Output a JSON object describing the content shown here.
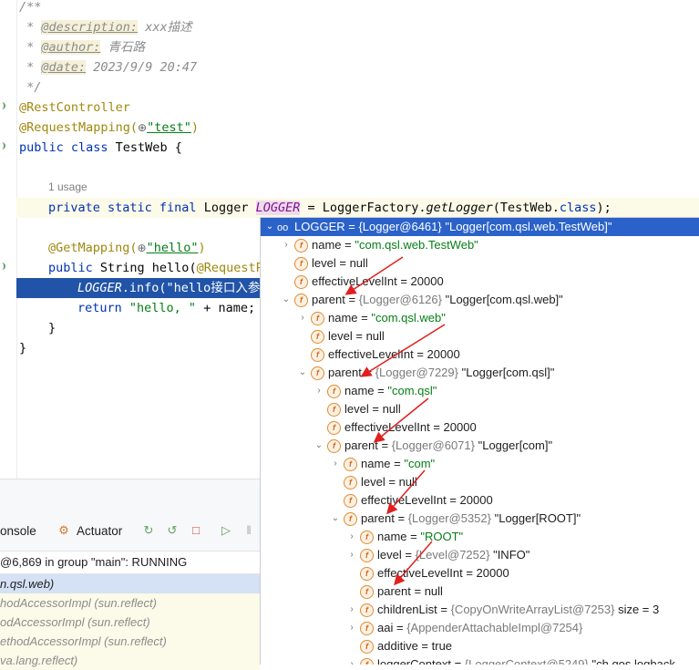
{
  "editor": {
    "comment_open": "/**",
    "desc_tag": "@description:",
    "desc_text": " xxx描述",
    "author_tag": "@author:",
    "author_text": " 青石路",
    "date_tag": "@date:",
    "date_text": " 2023/9/9 20:47",
    "comment_close": " */",
    "ann_rest": "@RestController",
    "ann_reqmap": "@RequestMapping(",
    "reqmap_value": "\"test\"",
    "reqmap_close": ")",
    "class_kw": "public class ",
    "class_name": "TestWeb {",
    "usage_hint": "1 usage",
    "field_kw": "private static final ",
    "field_type": "Logger ",
    "field_name": "LOGGER",
    "field_eq": " = LoggerFactory.",
    "field_method": "getLogger",
    "field_args": "(TestWeb.",
    "field_class_kw": "class",
    "field_end": ");",
    "ann_get": "@GetMapping(",
    "get_value": "\"hello\"",
    "get_close": ")",
    "method_kw": "public ",
    "method_sig": "String hello(",
    "method_ann": "@RequestP",
    "exec_logger": "LOGGER",
    "exec_rest": ".info(\"hello接口入参",
    "return_kw": "return ",
    "return_str": "\"hello, \"",
    "return_rest": " + name;",
    "brace_inner": "}",
    "brace_outer": "}"
  },
  "bottom": {
    "tab_console": "onsole",
    "tab_actuator": "Actuator",
    "thread_status": "@6,869 in group \"main\": RUNNING",
    "frames": [
      "n.qsl.web)",
      "hodAccessorImpl (sun.reflect)",
      "odAccessorImpl (sun.reflect)",
      "ethodAccessorImpl (sun.reflect)",
      "va.lang.reflect)"
    ]
  },
  "debug_tree": [
    {
      "indent": 0,
      "expander": "⌄",
      "icon": "oo",
      "name": "LOGGER",
      "eq": " = ",
      "ref": "{Logger@6461}",
      "value": " \"Logger[com.qsl.web.TestWeb]\"",
      "str": "",
      "selected": true
    },
    {
      "indent": 1,
      "expander": "›",
      "icon": "f",
      "name": "name",
      "eq": " = ",
      "ref": "",
      "value": "",
      "str": "\"com.qsl.web.TestWeb\""
    },
    {
      "indent": 1,
      "expander": "",
      "icon": "f",
      "name": "level",
      "eq": " = ",
      "ref": "",
      "value": "null",
      "str": ""
    },
    {
      "indent": 1,
      "expander": "",
      "icon": "f",
      "name": "effectiveLevelInt",
      "eq": " = ",
      "ref": "",
      "value": "20000",
      "str": ""
    },
    {
      "indent": 1,
      "expander": "⌄",
      "icon": "f",
      "name": "parent",
      "eq": " = ",
      "ref": "{Logger@6126}",
      "value": " \"Logger[com.qsl.web]\"",
      "str": ""
    },
    {
      "indent": 2,
      "expander": "›",
      "icon": "f",
      "name": "name",
      "eq": " = ",
      "ref": "",
      "value": "",
      "str": "\"com.qsl.web\""
    },
    {
      "indent": 2,
      "expander": "",
      "icon": "f",
      "name": "level",
      "eq": " = ",
      "ref": "",
      "value": "null",
      "str": ""
    },
    {
      "indent": 2,
      "expander": "",
      "icon": "f",
      "name": "effectiveLevelInt",
      "eq": " = ",
      "ref": "",
      "value": "20000",
      "str": ""
    },
    {
      "indent": 2,
      "expander": "⌄",
      "icon": "f",
      "name": "parent",
      "eq": " = ",
      "ref": "{Logger@7229}",
      "value": " \"Logger[com.qsl]\"",
      "str": ""
    },
    {
      "indent": 3,
      "expander": "›",
      "icon": "f",
      "name": "name",
      "eq": " = ",
      "ref": "",
      "value": "",
      "str": "\"com.qsl\""
    },
    {
      "indent": 3,
      "expander": "",
      "icon": "f",
      "name": "level",
      "eq": " = ",
      "ref": "",
      "value": "null",
      "str": ""
    },
    {
      "indent": 3,
      "expander": "",
      "icon": "f",
      "name": "effectiveLevelInt",
      "eq": " = ",
      "ref": "",
      "value": "20000",
      "str": ""
    },
    {
      "indent": 3,
      "expander": "⌄",
      "icon": "f",
      "name": "parent",
      "eq": " = ",
      "ref": "{Logger@6071}",
      "value": " \"Logger[com]\"",
      "str": ""
    },
    {
      "indent": 4,
      "expander": "›",
      "icon": "f",
      "name": "name",
      "eq": " = ",
      "ref": "",
      "value": "",
      "str": "\"com\""
    },
    {
      "indent": 4,
      "expander": "",
      "icon": "f",
      "name": "level",
      "eq": " = ",
      "ref": "",
      "value": "null",
      "str": ""
    },
    {
      "indent": 4,
      "expander": "",
      "icon": "f",
      "name": "effectiveLevelInt",
      "eq": " = ",
      "ref": "",
      "value": "20000",
      "str": ""
    },
    {
      "indent": 4,
      "expander": "⌄",
      "icon": "f",
      "name": "parent",
      "eq": " = ",
      "ref": "{Logger@5352}",
      "value": " \"Logger[ROOT]\"",
      "str": ""
    },
    {
      "indent": 5,
      "expander": "›",
      "icon": "f",
      "name": "name",
      "eq": " = ",
      "ref": "",
      "value": "",
      "str": "\"ROOT\""
    },
    {
      "indent": 5,
      "expander": "›",
      "icon": "f",
      "name": "level",
      "eq": " = ",
      "ref": "{Level@7252}",
      "value": " \"INFO\"",
      "str": ""
    },
    {
      "indent": 5,
      "expander": "",
      "icon": "f",
      "name": "effectiveLevelInt",
      "eq": " = ",
      "ref": "",
      "value": "20000",
      "str": ""
    },
    {
      "indent": 5,
      "expander": "",
      "icon": "f",
      "name": "parent",
      "eq": " = ",
      "ref": "",
      "value": "null",
      "str": ""
    },
    {
      "indent": 5,
      "expander": "›",
      "icon": "f",
      "name": "childrenList",
      "eq": " = ",
      "ref": "{CopyOnWriteArrayList@7253}",
      "value": "  size = 3",
      "str": ""
    },
    {
      "indent": 5,
      "expander": "›",
      "icon": "f",
      "name": "aai",
      "eq": " = ",
      "ref": "{AppenderAttachableImpl@7254}",
      "value": "",
      "str": ""
    },
    {
      "indent": 5,
      "expander": "",
      "icon": "f",
      "name": "additive",
      "eq": " = ",
      "ref": "",
      "value": "true",
      "str": ""
    },
    {
      "indent": 5,
      "expander": "›",
      "icon": "f",
      "name": "loggerContext",
      "eq": " = ",
      "ref": "{LoggerContext@5249}",
      "value": " \"ch.qos.logback",
      "str": ""
    }
  ],
  "colors": {
    "selection": "#2a62c9",
    "string": "#067d17",
    "keyword": "#0033b3",
    "arrow": "#e02020"
  }
}
